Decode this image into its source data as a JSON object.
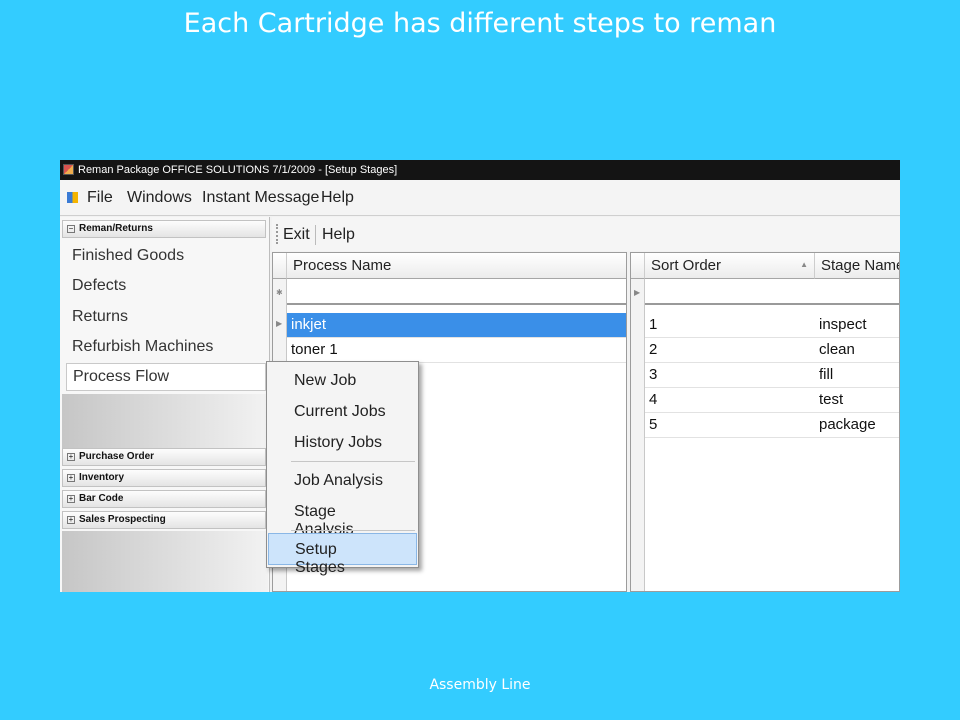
{
  "slide": {
    "title": "Each Cartridge has different steps to reman",
    "footer": "Assembly Line"
  },
  "window": {
    "title": "Reman Package OFFICE SOLUTIONS 7/1/2009 - [Setup Stages]"
  },
  "menubar": {
    "file": "File",
    "windows": "Windows",
    "instant_message": "Instant Message",
    "help": "Help"
  },
  "sidebar": {
    "group_reman": "Reman/Returns",
    "items": [
      "Finished Goods",
      "Defects",
      "Returns",
      "Refurbish Machines",
      "Process Flow"
    ],
    "groups": [
      "Purchase Order",
      "Inventory",
      "Bar Code",
      "Sales Prospecting"
    ]
  },
  "toolbar": {
    "exit": "Exit",
    "help": "Help"
  },
  "process_grid": {
    "column": "Process Name",
    "rows": [
      "inkjet",
      "toner 1"
    ]
  },
  "stage_grid": {
    "columns": [
      "Sort Order",
      "Stage Name"
    ],
    "rows": [
      {
        "sort_order": "1",
        "stage_name": "inspect"
      },
      {
        "sort_order": "2",
        "stage_name": "clean"
      },
      {
        "sort_order": "3",
        "stage_name": "fill"
      },
      {
        "sort_order": "4",
        "stage_name": "test"
      },
      {
        "sort_order": "5",
        "stage_name": "package"
      }
    ]
  },
  "context_menu": {
    "items": [
      "New Job",
      "Current Jobs",
      "History Jobs",
      "Job Analysis",
      "Stage Analysis",
      "Setup Stages"
    ]
  }
}
